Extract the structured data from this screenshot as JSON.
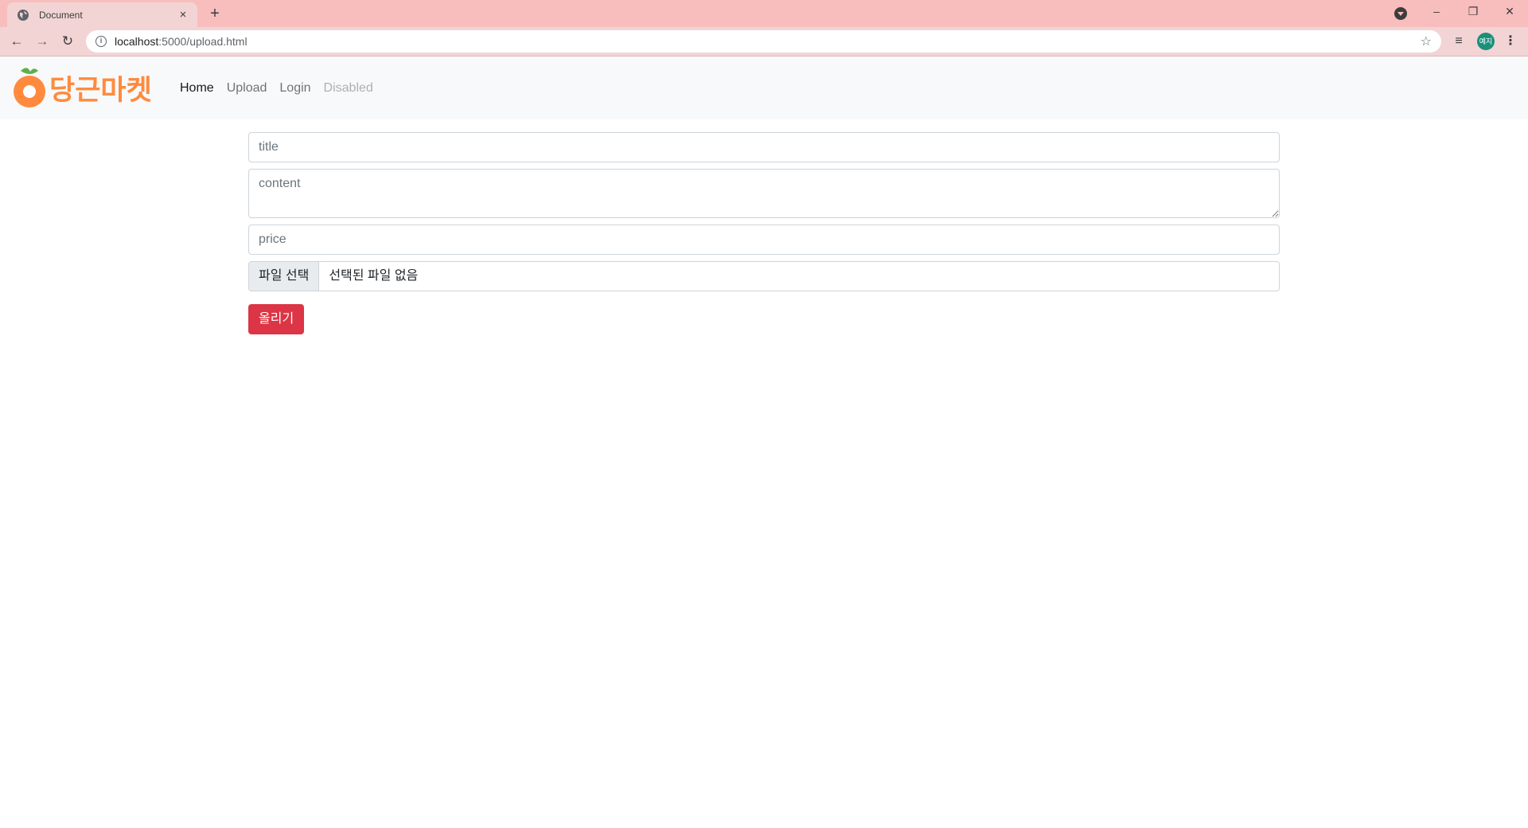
{
  "browser": {
    "tab_title": "Document",
    "tab_close": "×",
    "new_tab": "+",
    "url_host": "localhost",
    "url_rest": ":5000/upload.html",
    "avatar_text": "예지",
    "icons": {
      "favicon": "globe-icon",
      "back": "arrow-left-icon",
      "forward": "arrow-right-icon",
      "reload": "reload-icon",
      "info": "info-icon",
      "star": "star-icon",
      "media": "media-queue-icon",
      "menu": "kebab-menu-icon"
    }
  },
  "navbar": {
    "brand": "당근마켓",
    "links": [
      {
        "label": "Home",
        "state": "active"
      },
      {
        "label": "Upload",
        "state": "normal"
      },
      {
        "label": "Login",
        "state": "normal"
      },
      {
        "label": "Disabled",
        "state": "disabled"
      }
    ]
  },
  "form": {
    "title_placeholder": "title",
    "content_placeholder": "content",
    "price_placeholder": "price",
    "file_button": "파일 선택",
    "file_status": "선택된 파일 없음",
    "submit_label": "올리기"
  },
  "colors": {
    "brand_orange": "#ff8a3d",
    "submit_red": "#dc3545",
    "navbar_bg": "#f8f9fa",
    "tabstrip_bg": "#f8bdbd"
  }
}
